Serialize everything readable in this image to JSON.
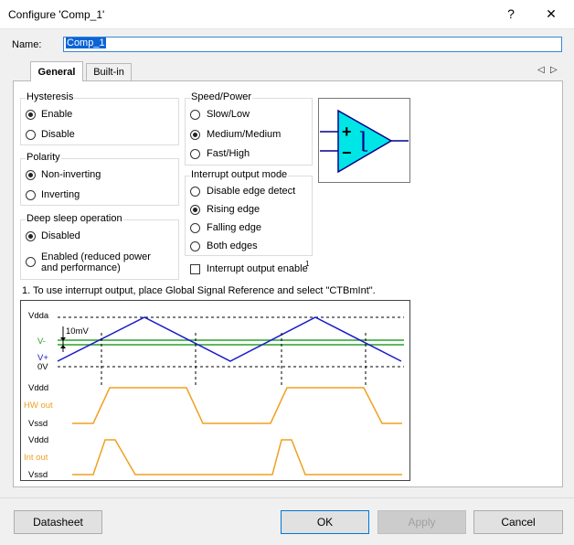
{
  "window": {
    "title": "Configure 'Comp_1'",
    "help_glyph": "?",
    "close_glyph": "✕"
  },
  "name_field": {
    "label": "Name:",
    "value": "Comp_1"
  },
  "tabs": [
    {
      "label": "General",
      "active": true
    },
    {
      "label": "Built-in",
      "active": false
    }
  ],
  "tab_nav": {
    "left": "◁",
    "right": "▷"
  },
  "hysteresis": {
    "title": "Hysteresis",
    "options": [
      {
        "label": "Enable",
        "selected": true
      },
      {
        "label": "Disable",
        "selected": false
      }
    ]
  },
  "polarity": {
    "title": "Polarity",
    "options": [
      {
        "label": "Non-inverting",
        "selected": true
      },
      {
        "label": "Inverting",
        "selected": false
      }
    ]
  },
  "deep_sleep": {
    "title": "Deep sleep operation",
    "options": [
      {
        "label": "Disabled",
        "selected": true
      },
      {
        "label": "Enabled (reduced power",
        "label2": "and performance)",
        "selected": false
      }
    ]
  },
  "speed_power": {
    "title": "Speed/Power",
    "options": [
      {
        "label": "Slow/Low",
        "selected": false
      },
      {
        "label": "Medium/Medium",
        "selected": true
      },
      {
        "label": "Fast/High",
        "selected": false
      }
    ]
  },
  "interrupt_mode": {
    "title": "Interrupt output mode",
    "options": [
      {
        "label": "Disable edge detect",
        "selected": false
      },
      {
        "label": "Rising edge",
        "selected": true
      },
      {
        "label": "Falling edge",
        "selected": false
      },
      {
        "label": "Both edges",
        "selected": false
      }
    ]
  },
  "interrupt_enable": {
    "label": "Interrupt output enable",
    "footnote_mark": "1",
    "checked": false
  },
  "footnote": "1. To use interrupt output, place Global Signal Reference and select \"CTBmInt\".",
  "comparator_symbol": {
    "plus": "+",
    "minus": "−",
    "fill": "#00e5e5",
    "stroke": "#00008b"
  },
  "waveform": {
    "labels": {
      "vdda": "Vdda",
      "vminus": "V-",
      "vplus": "V+",
      "zero": "0V",
      "delta": "10mV",
      "vddd_1": "Vddd",
      "hw_out": "HW out",
      "vssd_1": "Vssd",
      "vddd_2": "Vddd",
      "int_out": "Int out",
      "vssd_2": "Vssd"
    },
    "colors": {
      "triangle": "#1a1acc",
      "threshold": "#2ca02c",
      "output": "#f0a020",
      "grid": "#000000"
    }
  },
  "buttons": {
    "datasheet": "Datasheet",
    "ok": "OK",
    "apply": "Apply",
    "cancel": "Cancel"
  }
}
